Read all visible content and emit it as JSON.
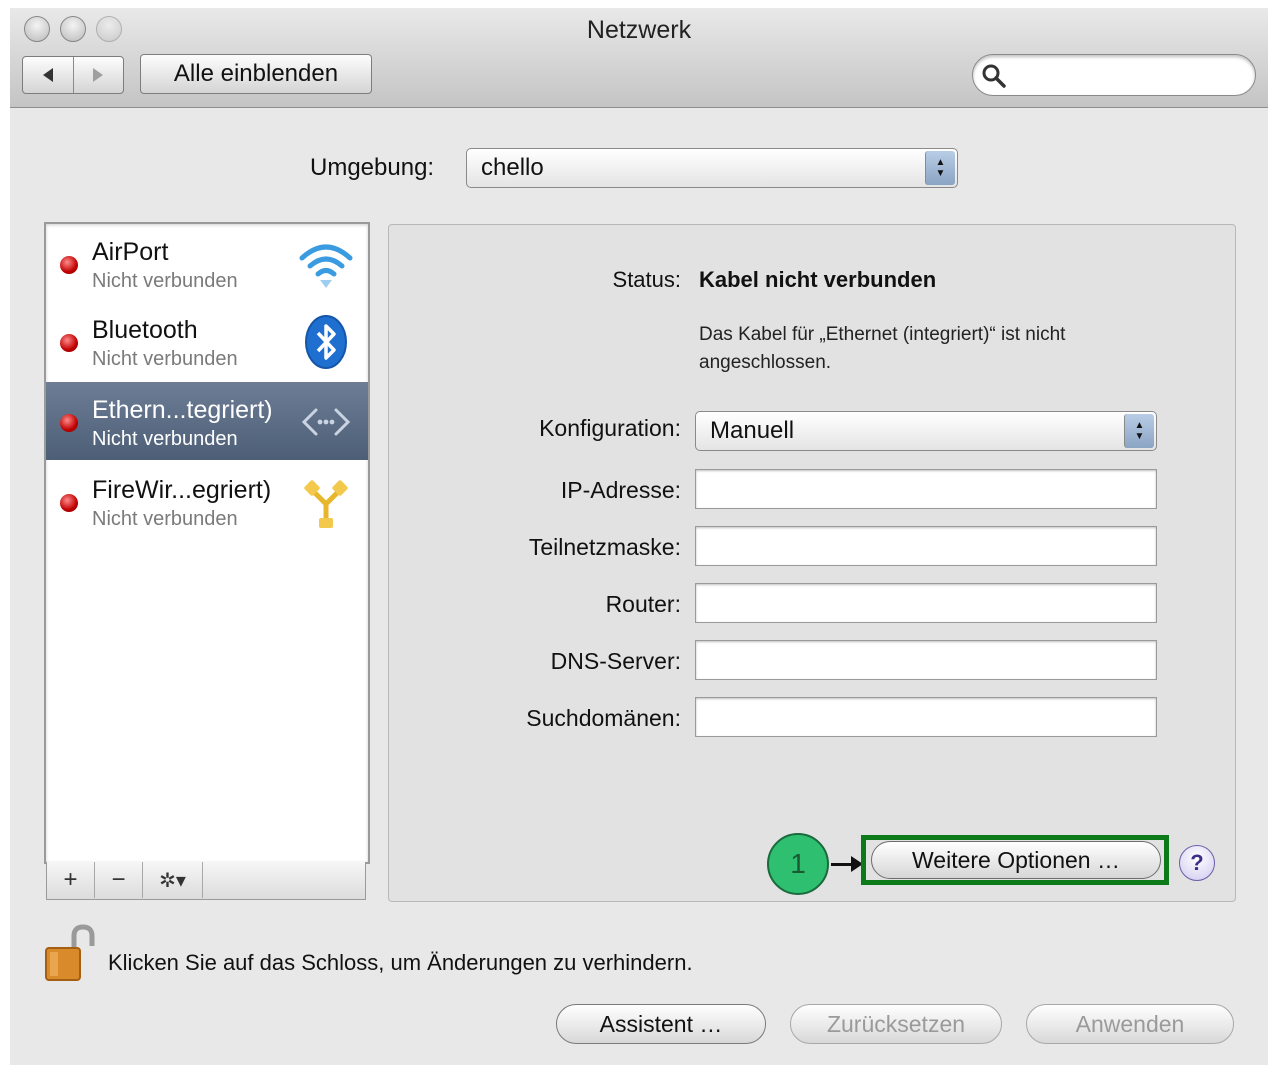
{
  "window": {
    "title": "Netzwerk"
  },
  "toolbar": {
    "back_icon": "triangle-left",
    "forward_icon": "triangle-right",
    "show_all_label": "Alle einblenden",
    "search_placeholder": "",
    "search_value": ""
  },
  "environment": {
    "label": "Umgebung:",
    "value": "chello"
  },
  "services": [
    {
      "name": "AirPort",
      "status": "Nicht verbunden",
      "icon": "wifi-icon",
      "selected": false
    },
    {
      "name": "Bluetooth",
      "status": "Nicht verbunden",
      "icon": "bluetooth-icon",
      "selected": false
    },
    {
      "name": "Ethern...tegriert)",
      "status": "Nicht verbunden",
      "icon": "ethernet-icon",
      "selected": true
    },
    {
      "name": "FireWir...egriert)",
      "status": "Nicht verbunden",
      "icon": "firewire-icon",
      "selected": false
    }
  ],
  "sidebar_buttons": {
    "add": "+",
    "remove": "−",
    "gear": "✲▾"
  },
  "detail": {
    "status_label": "Status:",
    "status_value": "Kabel nicht verbunden",
    "status_description": "Das Kabel für „Ethernet (integriert)“ ist nicht angeschlossen.",
    "configuration_label": "Konfiguration:",
    "configuration_value": "Manuell",
    "ip_label": "IP-Adresse:",
    "ip_value": "",
    "subnet_label": "Teilnetzmaske:",
    "subnet_value": "",
    "router_label": "Router:",
    "router_value": "",
    "dns_label": "DNS-Server:",
    "dns_value": "",
    "search_domains_label": "Suchdomänen:",
    "search_domains_value": "",
    "callout_number": "1",
    "more_options_label": "Weitere Optionen …",
    "help_label": "?"
  },
  "lock_text": "Klicken Sie auf das Schloss, um Änderungen zu verhindern.",
  "bottom_buttons": {
    "assistant": "Assistent …",
    "revert": "Zurücksetzen",
    "apply": "Anwenden"
  },
  "colors": {
    "status_dot": "#cc0000",
    "selected_row": "#566882",
    "highlight_box": "#0d7a1a",
    "callout_circle": "#2fbf71"
  }
}
